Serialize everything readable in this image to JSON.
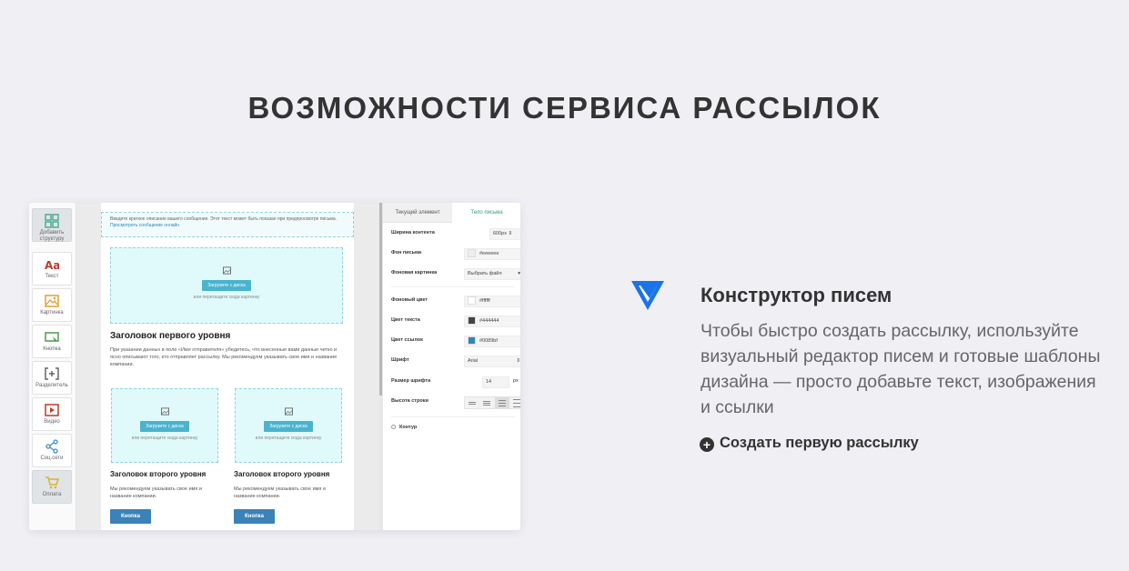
{
  "page_title": "ВОЗМОЖНОСТИ СЕРВИСА РАССЫЛОК",
  "editor": {
    "tools": [
      {
        "label": "Добавить структуру",
        "icon": "grid-icon"
      },
      {
        "label": "Текст",
        "icon": "text-icon"
      },
      {
        "label": "Картинка",
        "icon": "image-icon"
      },
      {
        "label": "Кнопка",
        "icon": "button-icon"
      },
      {
        "label": "Разделитель",
        "icon": "divider-icon"
      },
      {
        "label": "Видео",
        "icon": "video-icon"
      },
      {
        "label": "Соц.сети",
        "icon": "share-icon"
      },
      {
        "label": "Оплата",
        "icon": "cart-icon"
      }
    ],
    "preheader_text": "Введите краткое описание вашего сообщения. Этот текст может быть показан при предпросмотре письма.",
    "preheader_link": "Просмотреть сообщение онлайн",
    "upload_button": "Загрузите с диска",
    "upload_hint": "или перетащите сюда картинку",
    "heading1": "Заголовок первого уровня",
    "paragraph1": "При указании данных в поле «Имя отправителя» убедитесь, что внесенные вами данные четко и ясно описывают того, кто отправляет рассылку. Мы рекомендуем указывать свое имя и название компании.",
    "heading2": "Заголовок второго уровня",
    "paragraph2": "Мы рекомендуем указывать свое имя и название компании.",
    "button_label": "Кнопка",
    "tabs": [
      "Текущий элемент",
      "Тело письма"
    ],
    "props": {
      "content_width_label": "Ширина контента",
      "content_width_value": "600px",
      "bg_color_label": "Фон письма",
      "bg_color_value": "#eeeeee",
      "bg_image_label": "Фоновая картинка",
      "bg_image_value": "Выбрать файл",
      "body_bg_label": "Фоновый цвет",
      "body_bg_value": "#ffffff",
      "text_color_label": "Цвет текста",
      "text_color_value": "#444444",
      "link_color_label": "Цвет ссылок",
      "link_color_value": "#0089bf",
      "font_label": "Шрифт",
      "font_value": "Arial",
      "font_size_label": "Размер шрифта",
      "font_size_value": "14",
      "font_size_unit": "px",
      "line_height_label": "Высота строки",
      "outline_label": "Контур"
    }
  },
  "feature": {
    "title": "Конструктор писем",
    "description": "Чтобы быстро создать рассылку, используйте визуальный редактор писем и готовые шаблоны дизайна — просто добавьте текст, изображения и ссылки",
    "cta": "Создать первую рассылку",
    "accent_color": "#1a73e8"
  }
}
